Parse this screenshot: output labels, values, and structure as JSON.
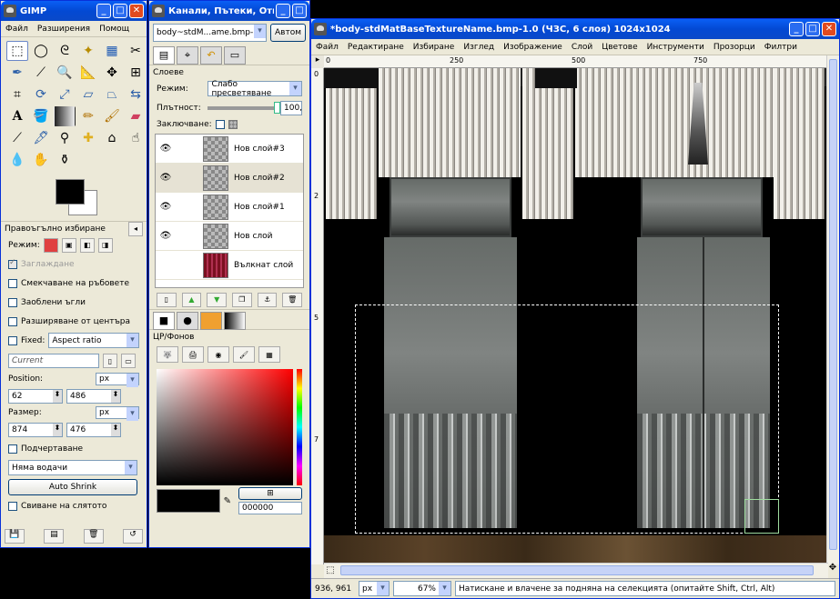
{
  "toolbox": {
    "title": "GIMP",
    "menu": [
      "Файл",
      "Разширения",
      "Помощ"
    ],
    "tools_icons": [
      "rect-select-icon",
      "ellipse-select-icon",
      "lasso-icon",
      "fuzzy-select-icon",
      "color-select-icon",
      "scissors-icon",
      "paths-icon",
      "color-picker-icon",
      "zoom-icon",
      "measure-icon",
      "move-icon",
      "align-icon",
      "crop-icon",
      "rotate-icon",
      "scale-icon",
      "shear-icon",
      "perspective-icon",
      "flip-icon",
      "text-icon",
      "bucket-fill-icon",
      "blend-icon",
      "pencil-icon",
      "paintbrush-icon",
      "eraser-icon",
      "airbrush-icon",
      "ink-icon",
      "clone-icon",
      "heal-icon",
      "perspective-clone-icon",
      "smudge-icon",
      "blur-icon",
      "dodge-icon"
    ],
    "options_title": "Правоъгълно избиране",
    "mode_label": "Режим:",
    "antialias_label": "Заглаждане",
    "feather_label": "Смекчаване на ръбовете",
    "rounded_label": "Заоблени ъгли",
    "expand_label": "Разширяване от центъра",
    "fixed_label": "Fixed:",
    "fixed_value": "Aspect ratio",
    "current_value": "Current",
    "position_label": "Position:",
    "position_unit": "px",
    "pos_x": "62",
    "pos_y": "486",
    "size_label": "Размер:",
    "size_unit": "px",
    "size_w": "874",
    "size_h": "476",
    "highlight_label": "Подчертаване",
    "guides_value": "Няма водачи",
    "auto_shrink_label": "Auto Shrink",
    "merged_label": "Свиване на слятото"
  },
  "layers": {
    "title": "Канали, Пътеки, Отмя...",
    "image_select": "body~stdM...ame.bmp-1",
    "auto_button": "Автом",
    "panel_title": "Слоеве",
    "mode_label": "Режим:",
    "mode_value": "Слабо пресветяване",
    "opacity_label": "Плътност:",
    "opacity_value": "100,",
    "lock_label": "Заключване:",
    "items": [
      {
        "name": "Нов слой#3"
      },
      {
        "name": "Нов слой#2"
      },
      {
        "name": "Нов слой#1"
      },
      {
        "name": "Нов слой"
      },
      {
        "name": "Вълкнат слой"
      }
    ],
    "fgbg_title": "ЦР/Фонов",
    "hex_value": "000000"
  },
  "image": {
    "title": "*body-stdMatBaseTextureName.bmp-1.0 (ЧЗС, 6 слоя) 1024x1024",
    "menu": [
      "Файл",
      "Редактиране",
      "Избиране",
      "Изглед",
      "Изображение",
      "Слой",
      "Цветове",
      "Инструменти",
      "Прозорци",
      "Филтри"
    ],
    "ruler_h": [
      "0",
      "250",
      "500",
      "750"
    ],
    "ruler_v": [
      "0",
      "2",
      "5",
      "7"
    ],
    "coords": "936, 961",
    "unit": "px",
    "zoom": "67%",
    "status": "Натискане и влачене за подняна на селекцията (опитайте Shift, Ctrl, Alt)"
  }
}
